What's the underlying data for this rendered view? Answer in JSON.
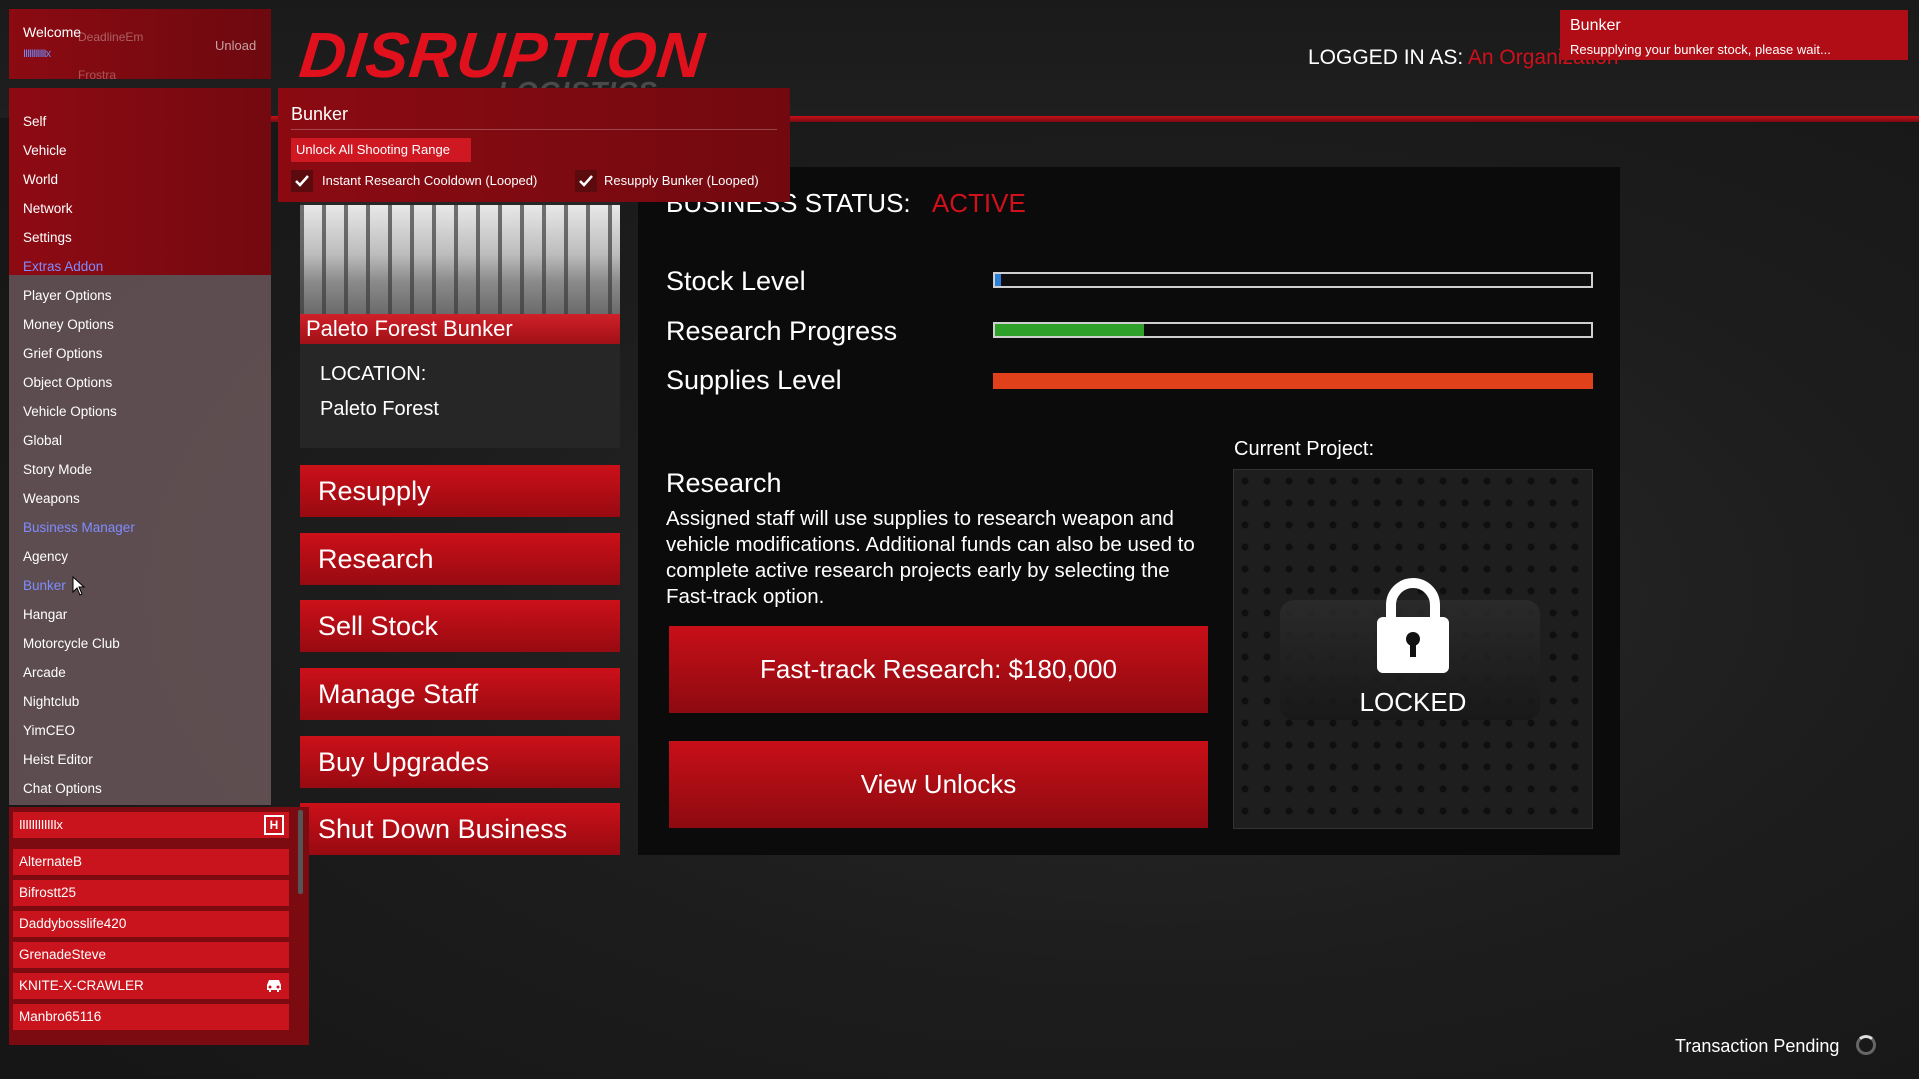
{
  "game": {
    "logo_main": "DISRUPTION",
    "logo_sub": "LOGISTICS",
    "logged_in_label": "LOGGED IN AS:",
    "logged_in_value": "An Organization",
    "business_status_label": "BUSINESS STATUS:",
    "business_status_value": "ACTIVE",
    "meters": [
      {
        "label": "Stock Level",
        "fraction": 0.01,
        "color": "#2a7fd6"
      },
      {
        "label": "Research Progress",
        "fraction": 0.25,
        "color": "#2fa12b"
      },
      {
        "label": "Supplies Level",
        "fraction": 1.0,
        "color": "#e0401a"
      }
    ],
    "research_title": "Research",
    "research_desc": "Assigned staff will use supplies to research weapon and vehicle modifications. Additional funds can also be used to complete active research projects early by selecting the Fast-track option.",
    "fast_track_label": "Fast-track Research: $180,000",
    "view_unlocks_label": "View Unlocks",
    "current_project_label": "Current Project:",
    "locked_label": "LOCKED",
    "location_name": "Paleto Forest Bunker",
    "location_label": "LOCATION:",
    "location_value": "Paleto Forest",
    "actions": [
      "Resupply",
      "Research",
      "Sell Stock",
      "Manage Staff",
      "Buy Upgrades",
      "Shut Down Business"
    ],
    "transaction_pending": "Transaction Pending"
  },
  "toast": {
    "title": "Bunker",
    "message": "Resupplying your bunker stock, please wait..."
  },
  "mod_menu": {
    "welcome": "Welcome",
    "welcome_ghost": "DeadlineEm",
    "welcome_user": "IIIIIIIIIIIx",
    "welcome_ghost2": "Frostra",
    "unload": "Unload",
    "items": [
      {
        "label": "Self",
        "kind": "item"
      },
      {
        "label": "Vehicle",
        "kind": "item"
      },
      {
        "label": "World",
        "kind": "item"
      },
      {
        "label": "Network",
        "kind": "item"
      },
      {
        "label": "Settings",
        "kind": "item"
      },
      {
        "label": "Extras Addon",
        "kind": "category"
      },
      {
        "label": "Player Options",
        "kind": "item"
      },
      {
        "label": "Money Options",
        "kind": "item"
      },
      {
        "label": "Grief Options",
        "kind": "item"
      },
      {
        "label": "Object Options",
        "kind": "item"
      },
      {
        "label": "Vehicle Options",
        "kind": "item"
      },
      {
        "label": "Global",
        "kind": "item"
      },
      {
        "label": "Story Mode",
        "kind": "item"
      },
      {
        "label": "Weapons",
        "kind": "item"
      },
      {
        "label": "Business Manager",
        "kind": "category"
      },
      {
        "label": "Agency",
        "kind": "item"
      },
      {
        "label": "Bunker",
        "kind": "selected"
      },
      {
        "label": "Hangar",
        "kind": "item"
      },
      {
        "label": "Motorcycle Club",
        "kind": "item"
      },
      {
        "label": "Arcade",
        "kind": "item"
      },
      {
        "label": "Nightclub",
        "kind": "item"
      },
      {
        "label": "YimCEO",
        "kind": "item"
      },
      {
        "label": "Heist Editor",
        "kind": "item"
      },
      {
        "label": "Chat Options",
        "kind": "item"
      }
    ],
    "popup": {
      "title": "Bunker",
      "button": "Unlock All Shooting Range",
      "check1": "Instant Research Cooldown (Looped)",
      "check2": "Resupply Bunker (Looped)",
      "check1_checked": true,
      "check2_checked": true
    },
    "players_header": "IIIIIIIIIIIIx",
    "host_icon": "H",
    "players": [
      "AlternateB",
      "Bifrostt25",
      "Daddybosslife420",
      "GrenadeSteve",
      "KNITE-X-CRAWLER",
      "Manbro65116"
    ]
  }
}
